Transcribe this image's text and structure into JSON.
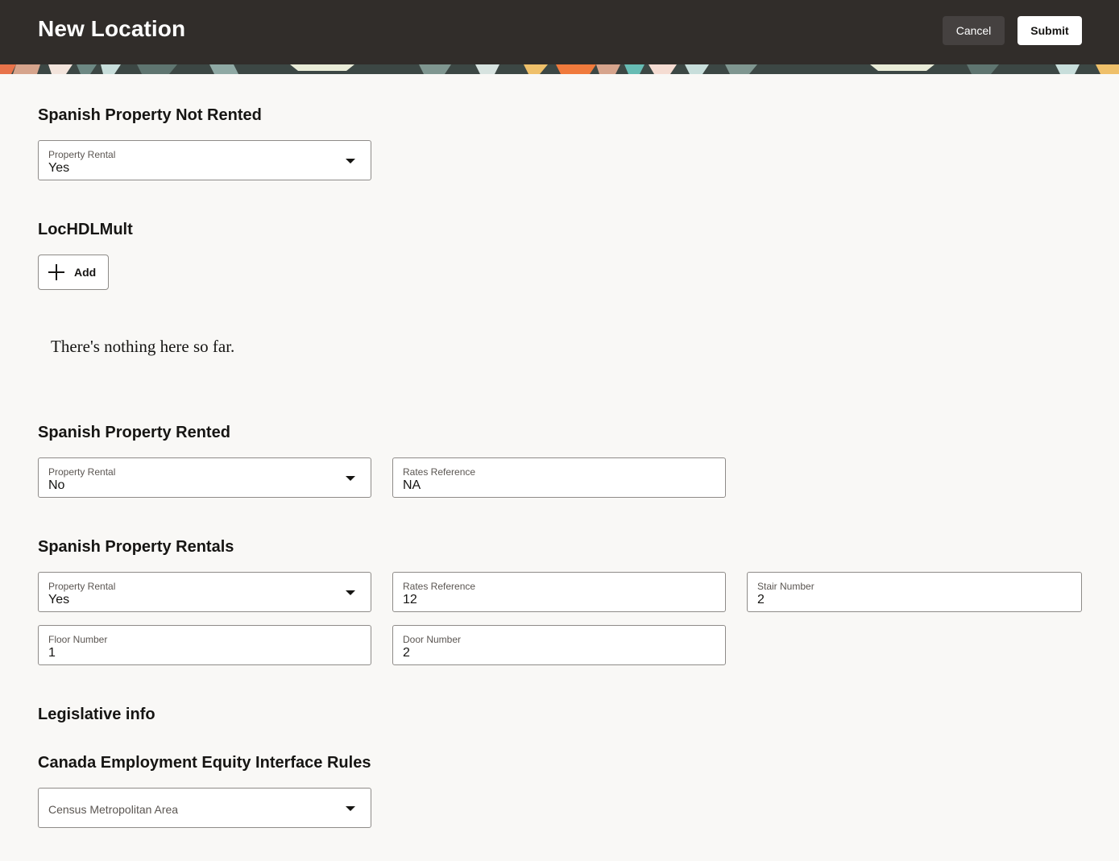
{
  "header": {
    "title": "New Location",
    "cancel_label": "Cancel",
    "submit_label": "Submit"
  },
  "sections": {
    "not_rented": {
      "title": "Spanish Property Not Rented",
      "property_rental": {
        "label": "Property Rental",
        "value": "Yes"
      }
    },
    "loc_hdl_mult": {
      "title": "LocHDLMult",
      "add_label": "Add",
      "empty_message": "There's nothing here so far."
    },
    "rented": {
      "title": "Spanish Property Rented",
      "property_rental": {
        "label": "Property Rental",
        "value": "No"
      },
      "rates_reference": {
        "label": "Rates Reference",
        "value": "NA"
      }
    },
    "rentals": {
      "title": "Spanish Property Rentals",
      "property_rental": {
        "label": "Property Rental",
        "value": "Yes"
      },
      "rates_reference": {
        "label": "Rates Reference",
        "value": "12"
      },
      "stair_number": {
        "label": "Stair Number",
        "value": "2"
      },
      "floor_number": {
        "label": "Floor Number",
        "value": "1"
      },
      "door_number": {
        "label": "Door Number",
        "value": "2"
      }
    },
    "legislative": {
      "title": "Legislative info"
    },
    "canada": {
      "title": "Canada Employment Equity Interface Rules",
      "census_metro_area": {
        "label": "Census Metropolitan Area",
        "value": ""
      }
    }
  },
  "icons": {
    "dropdown": "chevron-down-icon",
    "add": "plus-icon"
  },
  "colors": {
    "header_bg": "#312d2a",
    "page_bg": "#f9f8f6",
    "field_border": "#8e8b88"
  }
}
